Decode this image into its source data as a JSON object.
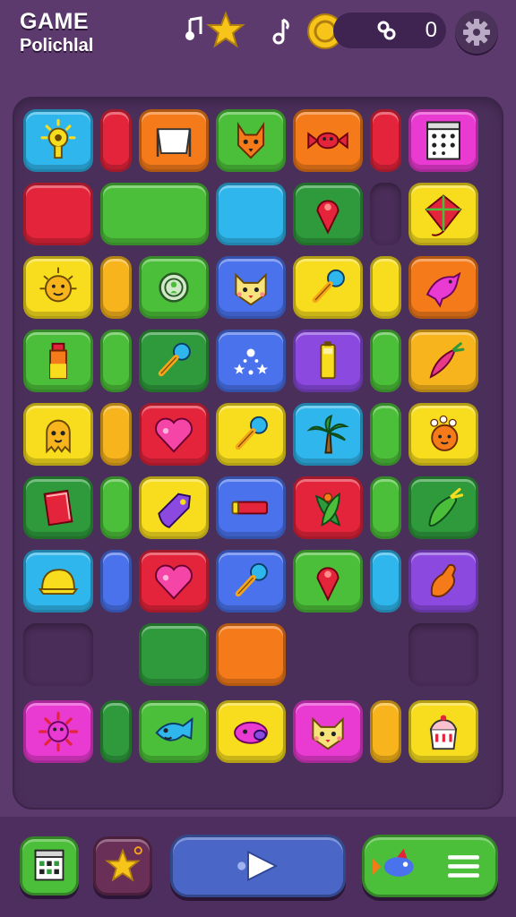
{
  "header": {
    "title": "GAME",
    "subtitle": "Polichlal",
    "score": "0"
  },
  "colors": {
    "background": "#5d3a6e",
    "board": "#4b2f5b",
    "cyan": "#2fb6ec",
    "red": "#e3243b",
    "orange": "#f47a1a",
    "green": "#4cbf3a",
    "darkgreen": "#2e9a3c",
    "magenta": "#e93ad2",
    "yellow": "#f7dd1e",
    "amber": "#f8b41c",
    "blue": "#4a72ec",
    "purple": "#8b49e0",
    "play": "#4a67c8"
  },
  "board": {
    "tiles": [
      {
        "name": "sun-tile",
        "color": "cyan",
        "icon": "sun-icon",
        "row": 0,
        "col": 0,
        "w": 1
      },
      {
        "name": "block-tile",
        "color": "red",
        "icon": "",
        "row": 0,
        "col": 1,
        "w": 0.5
      },
      {
        "name": "flag-tile",
        "color": "orange",
        "icon": "flag-icon",
        "row": 0,
        "col": 1.5,
        "w": 1
      },
      {
        "name": "fox-tile",
        "color": "green",
        "icon": "fox-icon",
        "row": 0,
        "col": 2.5,
        "w": 1
      },
      {
        "name": "candy-tile",
        "color": "orange",
        "icon": "candy-icon",
        "row": 0,
        "col": 3.5,
        "w": 1
      },
      {
        "name": "block-tile",
        "color": "red",
        "icon": "",
        "row": 0,
        "col": 4.5,
        "w": 0.5
      },
      {
        "name": "calendar-tile",
        "color": "magenta",
        "icon": "calendar-icon",
        "row": 0,
        "col": 5,
        "w": 1
      },
      {
        "name": "block-tile",
        "color": "red",
        "icon": "",
        "row": 1,
        "col": 0,
        "w": 1
      },
      {
        "name": "block-tile",
        "color": "green",
        "icon": "",
        "row": 1,
        "col": 1,
        "w": 1.5
      },
      {
        "name": "block-tile",
        "color": "cyan",
        "icon": "",
        "row": 1,
        "col": 2.5,
        "w": 1
      },
      {
        "name": "pin-tile",
        "color": "darkgreen",
        "icon": "pin-icon",
        "row": 1,
        "col": 3.5,
        "w": 1
      },
      {
        "name": "empty-slot",
        "color": "empty",
        "icon": "",
        "row": 1,
        "col": 4.5,
        "w": 0.5
      },
      {
        "name": "kite-tile",
        "color": "yellow",
        "icon": "kite-icon",
        "row": 1,
        "col": 5,
        "w": 1
      },
      {
        "name": "lion-tile",
        "color": "yellow",
        "icon": "lion-icon",
        "row": 2,
        "col": 0,
        "w": 1
      },
      {
        "name": "block-tile",
        "color": "amber",
        "icon": "",
        "row": 2,
        "col": 1,
        "w": 0.5
      },
      {
        "name": "ring-tile",
        "color": "green",
        "icon": "ring-icon",
        "row": 2,
        "col": 1.5,
        "w": 1
      },
      {
        "name": "cat-tile",
        "color": "blue",
        "icon": "cat-icon",
        "row": 2,
        "col": 2.5,
        "w": 1
      },
      {
        "name": "mic-tile",
        "color": "yellow",
        "icon": "microphone-icon",
        "row": 2,
        "col": 3.5,
        "w": 1
      },
      {
        "name": "block-tile",
        "color": "yellow",
        "icon": "",
        "row": 2,
        "col": 4.5,
        "w": 0.5
      },
      {
        "name": "dolphin-tile",
        "color": "orange",
        "icon": "dolphin-icon",
        "row": 2,
        "col": 5,
        "w": 1
      },
      {
        "name": "bottle-tile",
        "color": "green",
        "icon": "bottle-icon",
        "row": 3,
        "col": 0,
        "w": 1
      },
      {
        "name": "block-tile",
        "color": "green",
        "icon": "",
        "row": 3,
        "col": 1,
        "w": 0.5
      },
      {
        "name": "mic-tile",
        "color": "darkgreen",
        "icon": "microphone-icon",
        "row": 3,
        "col": 1.5,
        "w": 1
      },
      {
        "name": "stars-tile",
        "color": "blue",
        "icon": "sparkles-icon",
        "row": 3,
        "col": 2.5,
        "w": 1
      },
      {
        "name": "battery-tile",
        "color": "purple",
        "icon": "battery-icon",
        "row": 3,
        "col": 3.5,
        "w": 1
      },
      {
        "name": "block-tile",
        "color": "green",
        "icon": "",
        "row": 3,
        "col": 4.5,
        "w": 0.5
      },
      {
        "name": "carrot-tile",
        "color": "amber",
        "icon": "carrot-icon",
        "row": 3,
        "col": 5,
        "w": 1
      },
      {
        "name": "ghost-tile",
        "color": "yellow",
        "icon": "ghost-icon",
        "row": 4,
        "col": 0,
        "w": 1
      },
      {
        "name": "block-tile",
        "color": "amber",
        "icon": "",
        "row": 4,
        "col": 1,
        "w": 0.5
      },
      {
        "name": "heart-tile",
        "color": "red",
        "icon": "heart-icon",
        "row": 4,
        "col": 1.5,
        "w": 1
      },
      {
        "name": "mic-tile",
        "color": "yellow",
        "icon": "microphone-icon",
        "row": 4,
        "col": 2.5,
        "w": 1
      },
      {
        "name": "palm-tile",
        "color": "cyan",
        "icon": "palm-tree-icon",
        "row": 4,
        "col": 3.5,
        "w": 1
      },
      {
        "name": "block-tile",
        "color": "green",
        "icon": "",
        "row": 4,
        "col": 4.5,
        "w": 0.5
      },
      {
        "name": "hedgehog-tile",
        "color": "yellow",
        "icon": "hedgehog-icon",
        "row": 4,
        "col": 5,
        "w": 1
      },
      {
        "name": "book-tile",
        "color": "darkgreen",
        "icon": "book-icon",
        "row": 5,
        "col": 0,
        "w": 1
      },
      {
        "name": "block-tile",
        "color": "green",
        "icon": "",
        "row": 5,
        "col": 1,
        "w": 0.5
      },
      {
        "name": "tag-tile",
        "color": "yellow",
        "icon": "tag-icon",
        "row": 5,
        "col": 1.5,
        "w": 1
      },
      {
        "name": "bar-tile",
        "color": "blue",
        "icon": "bar-icon",
        "row": 5,
        "col": 2.5,
        "w": 1
      },
      {
        "name": "plant-tile",
        "color": "red",
        "icon": "plant-icon",
        "row": 5,
        "col": 3.5,
        "w": 1
      },
      {
        "name": "block-tile",
        "color": "green",
        "icon": "",
        "row": 5,
        "col": 4.5,
        "w": 0.5
      },
      {
        "name": "cucumber-tile",
        "color": "darkgreen",
        "icon": "cucumber-icon",
        "row": 5,
        "col": 5,
        "w": 1
      },
      {
        "name": "cap-tile",
        "color": "cyan",
        "icon": "cap-icon",
        "row": 6,
        "col": 0,
        "w": 1
      },
      {
        "name": "block-tile",
        "color": "blue",
        "icon": "",
        "row": 6,
        "col": 1,
        "w": 0.5
      },
      {
        "name": "heart-tile",
        "color": "red",
        "icon": "heart-icon",
        "row": 6,
        "col": 1.5,
        "w": 1
      },
      {
        "name": "mic-tile",
        "color": "blue",
        "icon": "microphone-icon",
        "row": 6,
        "col": 2.5,
        "w": 1
      },
      {
        "name": "pin-tile",
        "color": "green",
        "icon": "pin-icon",
        "row": 6,
        "col": 3.5,
        "w": 1
      },
      {
        "name": "block-tile",
        "color": "cyan",
        "icon": "",
        "row": 6,
        "col": 4.5,
        "w": 0.5
      },
      {
        "name": "glove-tile",
        "color": "purple",
        "icon": "glove-icon",
        "row": 6,
        "col": 5,
        "w": 1
      },
      {
        "name": "empty-slot",
        "color": "empty",
        "icon": "",
        "row": 7,
        "col": 0,
        "w": 1
      },
      {
        "name": "block-tile",
        "color": "darkgreen",
        "icon": "",
        "row": 7,
        "col": 1.5,
        "w": 1
      },
      {
        "name": "block-tile",
        "color": "orange",
        "icon": "",
        "row": 7,
        "col": 2.5,
        "w": 1
      },
      {
        "name": "empty-slot",
        "color": "empty",
        "icon": "",
        "row": 7,
        "col": 5,
        "w": 1
      },
      {
        "name": "virus-tile",
        "color": "magenta",
        "icon": "virus-icon",
        "row": 8,
        "col": 0,
        "w": 1
      },
      {
        "name": "block-tile",
        "color": "darkgreen",
        "icon": "",
        "row": 8,
        "col": 1,
        "w": 0.5
      },
      {
        "name": "fish-tile",
        "color": "green",
        "icon": "fish-icon",
        "row": 8,
        "col": 1.5,
        "w": 1
      },
      {
        "name": "shell-tile",
        "color": "yellow",
        "icon": "shell-icon",
        "row": 8,
        "col": 2.5,
        "w": 1
      },
      {
        "name": "cat-tile",
        "color": "magenta",
        "icon": "cat-icon",
        "row": 8,
        "col": 3.5,
        "w": 1
      },
      {
        "name": "block-tile",
        "color": "amber",
        "icon": "",
        "row": 8,
        "col": 4.5,
        "w": 0.5
      },
      {
        "name": "cake-tile",
        "color": "yellow",
        "icon": "cake-icon",
        "row": 8,
        "col": 5,
        "w": 1
      }
    ]
  },
  "footer": {
    "buttons": [
      {
        "name": "calendar-button",
        "icon": "calendar-icon"
      },
      {
        "name": "favorites-button",
        "icon": "star-icon"
      },
      {
        "name": "play-button",
        "icon": "play-icon"
      },
      {
        "name": "menu-button",
        "icon": "menu-icon"
      }
    ]
  }
}
